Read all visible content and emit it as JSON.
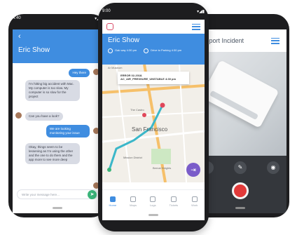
{
  "left_phone": {
    "status_left": "4:40",
    "chat_title": "Eric Show",
    "messages": [
      "Hey there",
      "I'm hitting big accident with Mac. My computer is too slow. My computer is so slow for the project",
      "Can you have a look?",
      "We are looking monitoring your issue",
      "Okay, things seem to be lessening as I'm using the other and the one to do them and the app more to see more deep"
    ],
    "input_placeholder": "Write your message here..."
  },
  "center_phone": {
    "status_left": "9:00",
    "title": "Eric Show",
    "trip_from": "Oak way 4:30 pm",
    "trip_to": "Drive to Parking 4:30 pm",
    "info_card": "ERROR 02-2018. AC_AIR_PRESSURE_UNSTABLE 4:30 pm",
    "map_labels": [
      "Ar Museum",
      "The Castro",
      "San Francisco",
      "Mission District",
      "Bernal Heights"
    ],
    "tabs": [
      "Home",
      "Maps",
      "Logs",
      "Tickets",
      "Work"
    ]
  },
  "right_phone": {
    "title": "Report Incident"
  },
  "colors": {
    "primary_blue": "#3f8de0",
    "green": "#3bb47a",
    "record_red": "#e23a3a",
    "fab_purple": "#7a5cc9"
  }
}
